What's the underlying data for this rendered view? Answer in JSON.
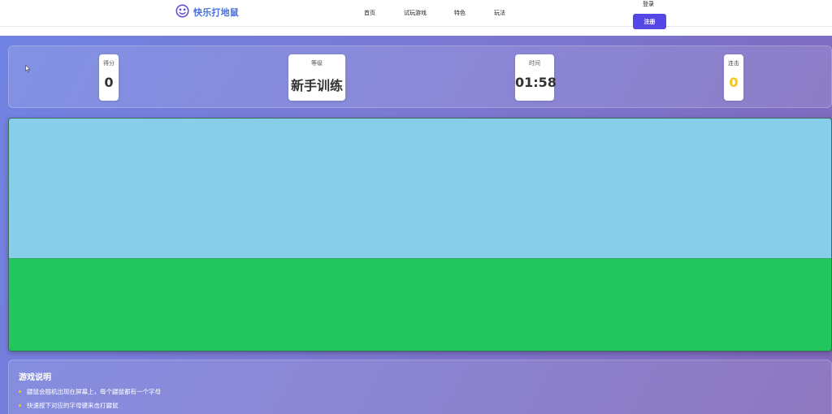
{
  "header": {
    "logo_text": "快乐打地鼠",
    "nav": [
      {
        "label": "首页"
      },
      {
        "label": "试玩游戏"
      },
      {
        "label": "特色"
      },
      {
        "label": "玩法"
      }
    ],
    "login_label": "登录",
    "register_label": "注册"
  },
  "stats": {
    "score": {
      "label": "得分",
      "value": "0"
    },
    "level": {
      "label": "等级",
      "value": "新手训练"
    },
    "time": {
      "label": "时间",
      "value": "01:58"
    },
    "combo": {
      "label": "连击",
      "value": "0"
    }
  },
  "game": {
    "sky_color": "#87ceeb",
    "grass_color": "#22c55e"
  },
  "instructions": {
    "title": "游戏说明",
    "items": [
      "鼹鼠会随机出现在屏幕上，每个鼹鼠都有一个字母",
      "快速按下对应的字母键来击打鼹鼠"
    ]
  },
  "colors": {
    "accent": "#5546e6",
    "logo": "#4a6fd6",
    "combo": "#f5c518"
  }
}
